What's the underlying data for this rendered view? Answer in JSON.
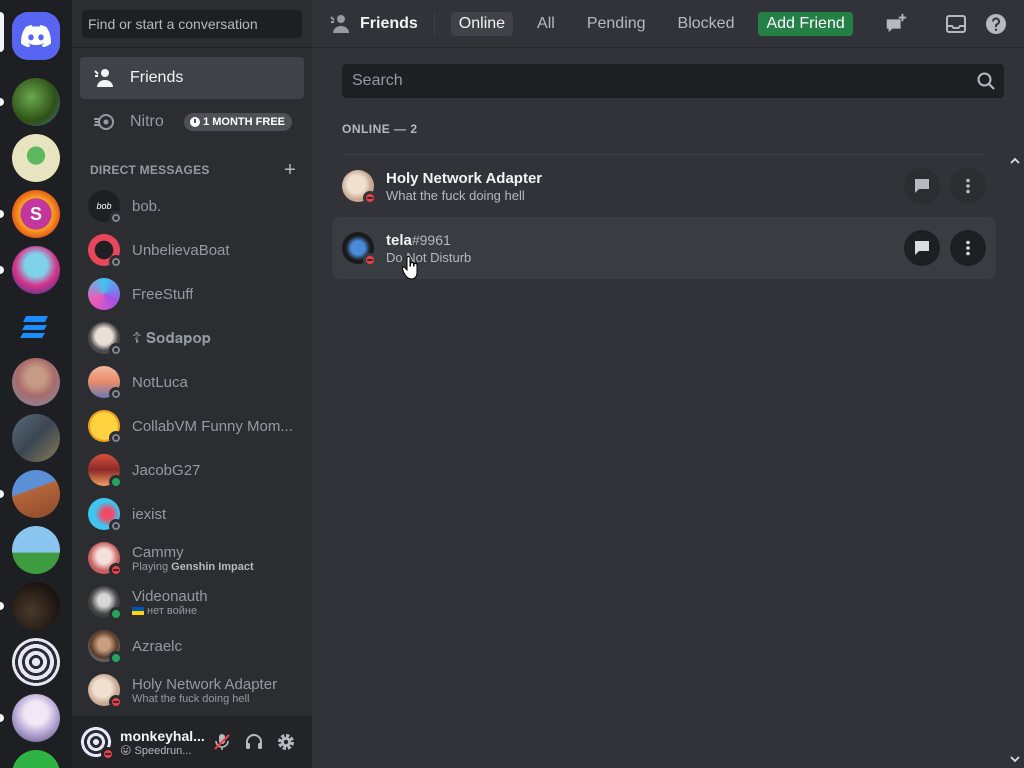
{
  "sidebar": {
    "search_placeholder": "Find or start a conversation",
    "nav": {
      "friends_label": "Friends",
      "nitro_label": "Nitro",
      "nitro_badge": "1 MONTH FREE"
    },
    "dm_header": "DIRECT MESSAGES",
    "dms": [
      {
        "name": "bob.",
        "status": "offline",
        "activity": ""
      },
      {
        "name": "UnbelievaBoat",
        "status": "offline",
        "activity": ""
      },
      {
        "name": "FreeStuff",
        "status": "none",
        "activity": ""
      },
      {
        "name": "☦ 𝐒𝐨𝐝𝐚𝐩𝐨𝐩",
        "status": "offline",
        "activity": ""
      },
      {
        "name": "NotLuca",
        "status": "offline",
        "activity": ""
      },
      {
        "name": "CollabVM Funny Mom...",
        "status": "offline",
        "activity": ""
      },
      {
        "name": "JacobG27",
        "status": "online",
        "activity": ""
      },
      {
        "name": "iexist",
        "status": "offline",
        "activity": ""
      },
      {
        "name": "Cammy",
        "status": "dnd",
        "activity_prefix": "Playing ",
        "activity": "Genshin Impact"
      },
      {
        "name": "Videonauth",
        "status": "online",
        "activity": "нет войне"
      },
      {
        "name": "Azraelc",
        "status": "online",
        "activity": ""
      },
      {
        "name": "Holy Network Adapter",
        "status": "dnd",
        "activity": "What the fuck doing hell"
      }
    ],
    "user": {
      "name": "monkeyhal...",
      "status_text": "😛 Speedrun..."
    }
  },
  "main": {
    "title": "Friends",
    "tabs": [
      "Online",
      "All",
      "Pending",
      "Blocked"
    ],
    "add_friend": "Add Friend",
    "search_placeholder": "Search",
    "section_title": "ONLINE — 2",
    "friends": [
      {
        "name": "Holy Network Adapter",
        "discriminator": "",
        "subtext": "What the fuck doing hell",
        "status": "dnd"
      },
      {
        "name": "tela",
        "discriminator": "#9961",
        "subtext": "Do Not Disturb",
        "status": "dnd"
      }
    ]
  },
  "colors": {
    "blurple": "#5865f2",
    "add_friend_green": "#248046",
    "online": "#23a55a",
    "dnd": "#f23f43",
    "offline": "#80848e"
  }
}
